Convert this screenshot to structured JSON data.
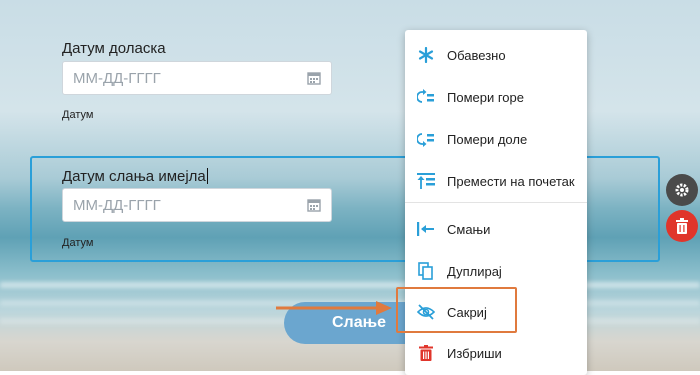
{
  "form": {
    "arrival_date": {
      "label": "Датум доласка",
      "placeholder": "ММ-ДД-ГГГГ",
      "help": "Датум"
    },
    "email_date": {
      "label": "Датум слања имејла",
      "placeholder": "ММ-ДД-ГГГГ",
      "help": "Датум"
    },
    "submit_label": "Слање"
  },
  "context_menu": {
    "items": [
      {
        "label": "Обавезно",
        "icon": "asterisk-icon"
      },
      {
        "label": "Помери горе",
        "icon": "move-up-icon"
      },
      {
        "label": "Помери доле",
        "icon": "move-down-icon"
      },
      {
        "label": "Премести на почетак",
        "icon": "move-to-top-icon"
      },
      {
        "label": "Смањи",
        "icon": "shrink-icon"
      },
      {
        "label": "Дуплирај",
        "icon": "duplicate-icon"
      },
      {
        "label": "Сакриј",
        "icon": "eye-off-icon"
      },
      {
        "label": "Избриши",
        "icon": "trash-icon"
      }
    ]
  },
  "colors": {
    "accent": "#2a9fd8",
    "highlight": "#e07a3e",
    "delete": "#e0352b",
    "settings": "#4a4a4a",
    "submit": "#6ba6cf"
  }
}
